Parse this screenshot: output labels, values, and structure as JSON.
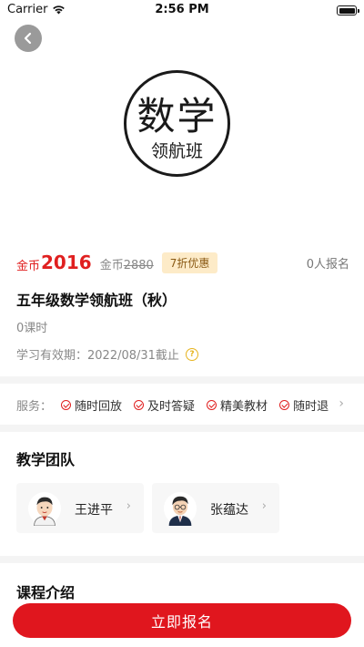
{
  "status_bar": {
    "carrier": "Carrier",
    "time": "2:56 PM"
  },
  "cover": {
    "title": "数学",
    "subtitle": "领航班"
  },
  "pricing": {
    "currency_label": "金币",
    "price": "2016",
    "original_label": "金币",
    "original_price": "2880",
    "discount": "7折优惠",
    "enroll_count": "0人报名"
  },
  "course": {
    "title": "五年级数学领航班（秋）",
    "lessons": "0课时",
    "validity": "学习有效期：2022/08/31截止"
  },
  "services": {
    "label": "服务：",
    "items": [
      "随时回放",
      "及时答疑",
      "精美教材",
      "随时退"
    ]
  },
  "team": {
    "title": "教学团队",
    "teachers": [
      {
        "name": "王进平"
      },
      {
        "name": "张蕴达"
      }
    ]
  },
  "intro": {
    "title": "课程介绍"
  },
  "actions": {
    "enroll_button": "立即报名"
  },
  "colors": {
    "accent": "#e02020",
    "badge_bg": "#fdebc8"
  }
}
